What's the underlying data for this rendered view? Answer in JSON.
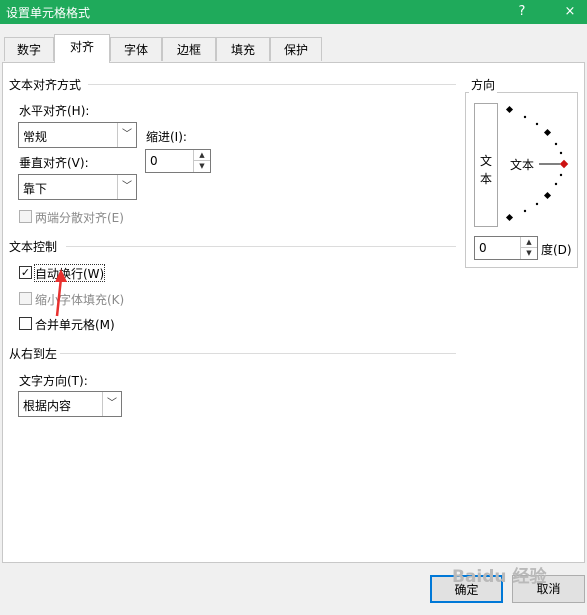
{
  "window": {
    "title": "设置单元格格式",
    "help": "?",
    "close": "×"
  },
  "tabs": [
    "数字",
    "对齐",
    "字体",
    "边框",
    "填充",
    "保护"
  ],
  "alignment": {
    "group_title": "文本对齐方式",
    "horizontal_label": "水平对齐(H):",
    "horizontal_value": "常规",
    "vertical_label": "垂直对齐(V):",
    "vertical_value": "靠下",
    "indent_label": "缩进(I):",
    "indent_value": "0",
    "distributed_label": "两端分散对齐(E)"
  },
  "text_control": {
    "group_title": "文本控制",
    "wrap_label": "自动换行(W)",
    "wrap_checked": true,
    "shrink_label": "缩小字体填充(K)",
    "merge_label": "合并单元格(M)"
  },
  "rtl": {
    "group_title": "从右到左",
    "direction_label": "文字方向(T):",
    "direction_value": "根据内容"
  },
  "orientation": {
    "group_title": "方向",
    "vertical_char1": "文",
    "vertical_char2": "本",
    "dial_text": "文本",
    "degree_value": "0",
    "degree_label": "度(D)"
  },
  "footer": {
    "ok": "确定",
    "cancel": "取消"
  },
  "watermark": "Baidu 经验",
  "colors": {
    "titlebar": "#1faa5b",
    "annotation_arrow": "#e8302e",
    "dial_marker": "#cc1111"
  }
}
